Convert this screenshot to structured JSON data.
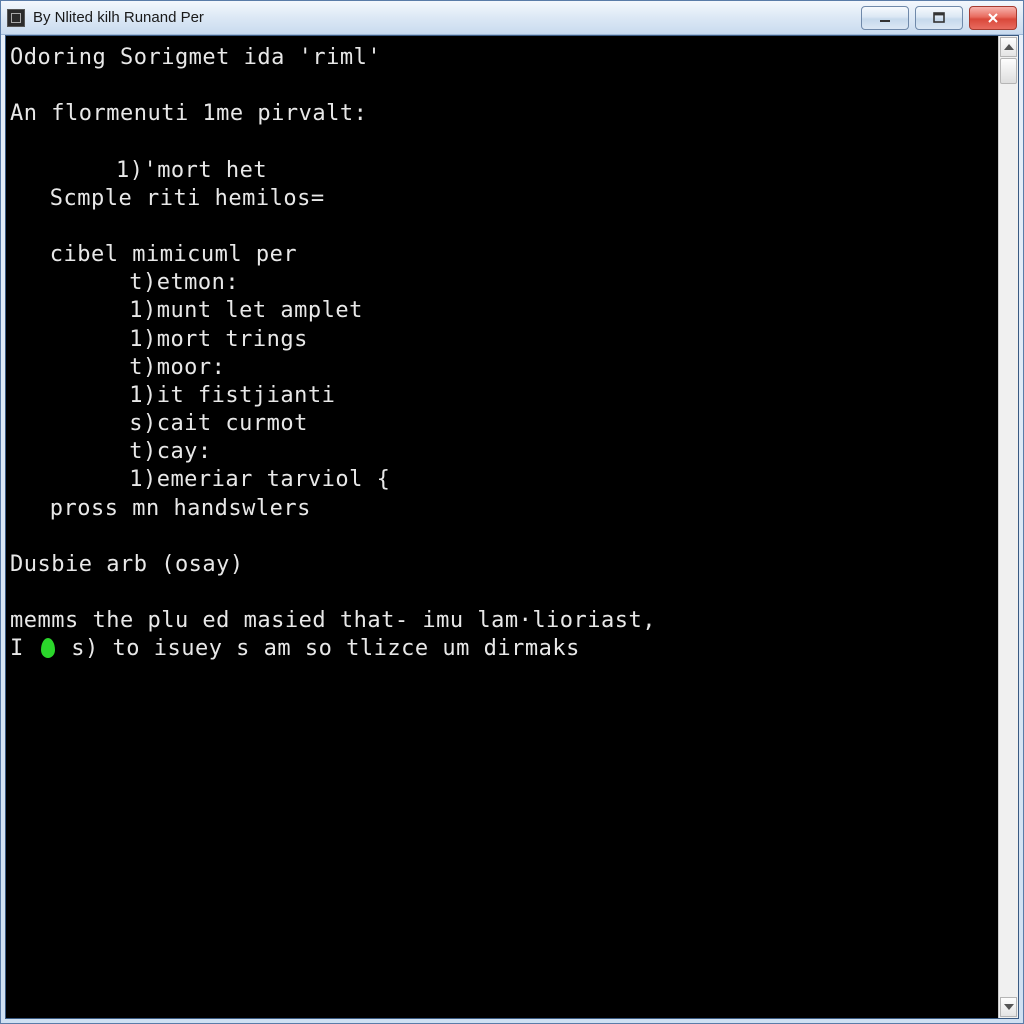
{
  "window": {
    "title": "By Nlited kilh Runand Per"
  },
  "terminal": {
    "lines": [
      {
        "indent": "indent0",
        "text": "Odoring Sorigmet ida 'riml'"
      },
      {
        "indent": "indent0",
        "text": ""
      },
      {
        "indent": "indent0",
        "text": "An flormenuti 1me pirvalt:"
      },
      {
        "indent": "indent0",
        "text": ""
      },
      {
        "indent": "indent1",
        "text": "1)'mort het"
      },
      {
        "indent": "indent-half",
        "text": "Scmple riti hemilos="
      },
      {
        "indent": "indent0",
        "text": ""
      },
      {
        "indent": "indent-half",
        "text": "cibel mimicuml per"
      },
      {
        "indent": "indent2",
        "text": "t)etmon:"
      },
      {
        "indent": "indent2",
        "text": "1)munt let amplet"
      },
      {
        "indent": "indent2",
        "text": "1)mort trings"
      },
      {
        "indent": "indent2",
        "text": "t)moor:"
      },
      {
        "indent": "indent2",
        "text": "1)it fistjianti"
      },
      {
        "indent": "indent2",
        "text": "s)cait curmot"
      },
      {
        "indent": "indent2",
        "text": "t)cay:"
      },
      {
        "indent": "indent2",
        "text": "1)emeriar tarviol {"
      },
      {
        "indent": "indent-half",
        "text": "pross mn handswlers"
      },
      {
        "indent": "indent0",
        "text": ""
      },
      {
        "indent": "indent0",
        "text": "Dusbie arb (osay)"
      },
      {
        "indent": "indent0",
        "text": ""
      },
      {
        "indent": "indent0",
        "text": "memms the plu ed masied that- imu lam·lioriast,"
      }
    ],
    "last_line_prefix": "I ",
    "last_line_after_cursor": " s) to isuey s am so tlizce um dirmaks"
  }
}
